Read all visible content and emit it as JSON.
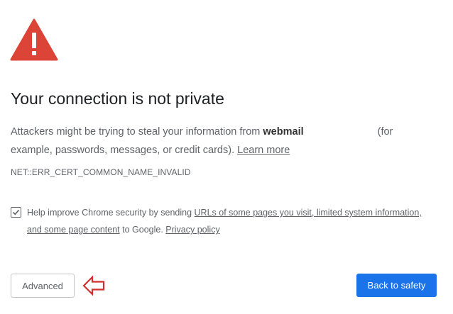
{
  "icons": {
    "warning": "warning-triangle-icon",
    "checkbox_check": "checkmark-icon",
    "annotation_arrow": "left-arrow-icon"
  },
  "colors": {
    "warning_red": "#db4437",
    "primary_button": "#1a73e8",
    "annotation_arrow": "#d32f2f"
  },
  "heading": "Your connection is not private",
  "description": {
    "before_host": "Attackers might be trying to steal your information from ",
    "host": "webmail",
    "after_host": "(for example, passwords, messages, or credit cards). ",
    "learn_more": "Learn more"
  },
  "error_code": "NET::ERR_CERT_COMMON_NAME_INVALID",
  "optin": {
    "checked": true,
    "before_link": "Help improve Chrome security by sending ",
    "link_urls": "URLs of some pages you visit, limited system information, and some page content",
    "middle": " to Google. ",
    "link_privacy": "Privacy policy"
  },
  "buttons": {
    "advanced": "Advanced",
    "back_to_safety": "Back to safety"
  }
}
